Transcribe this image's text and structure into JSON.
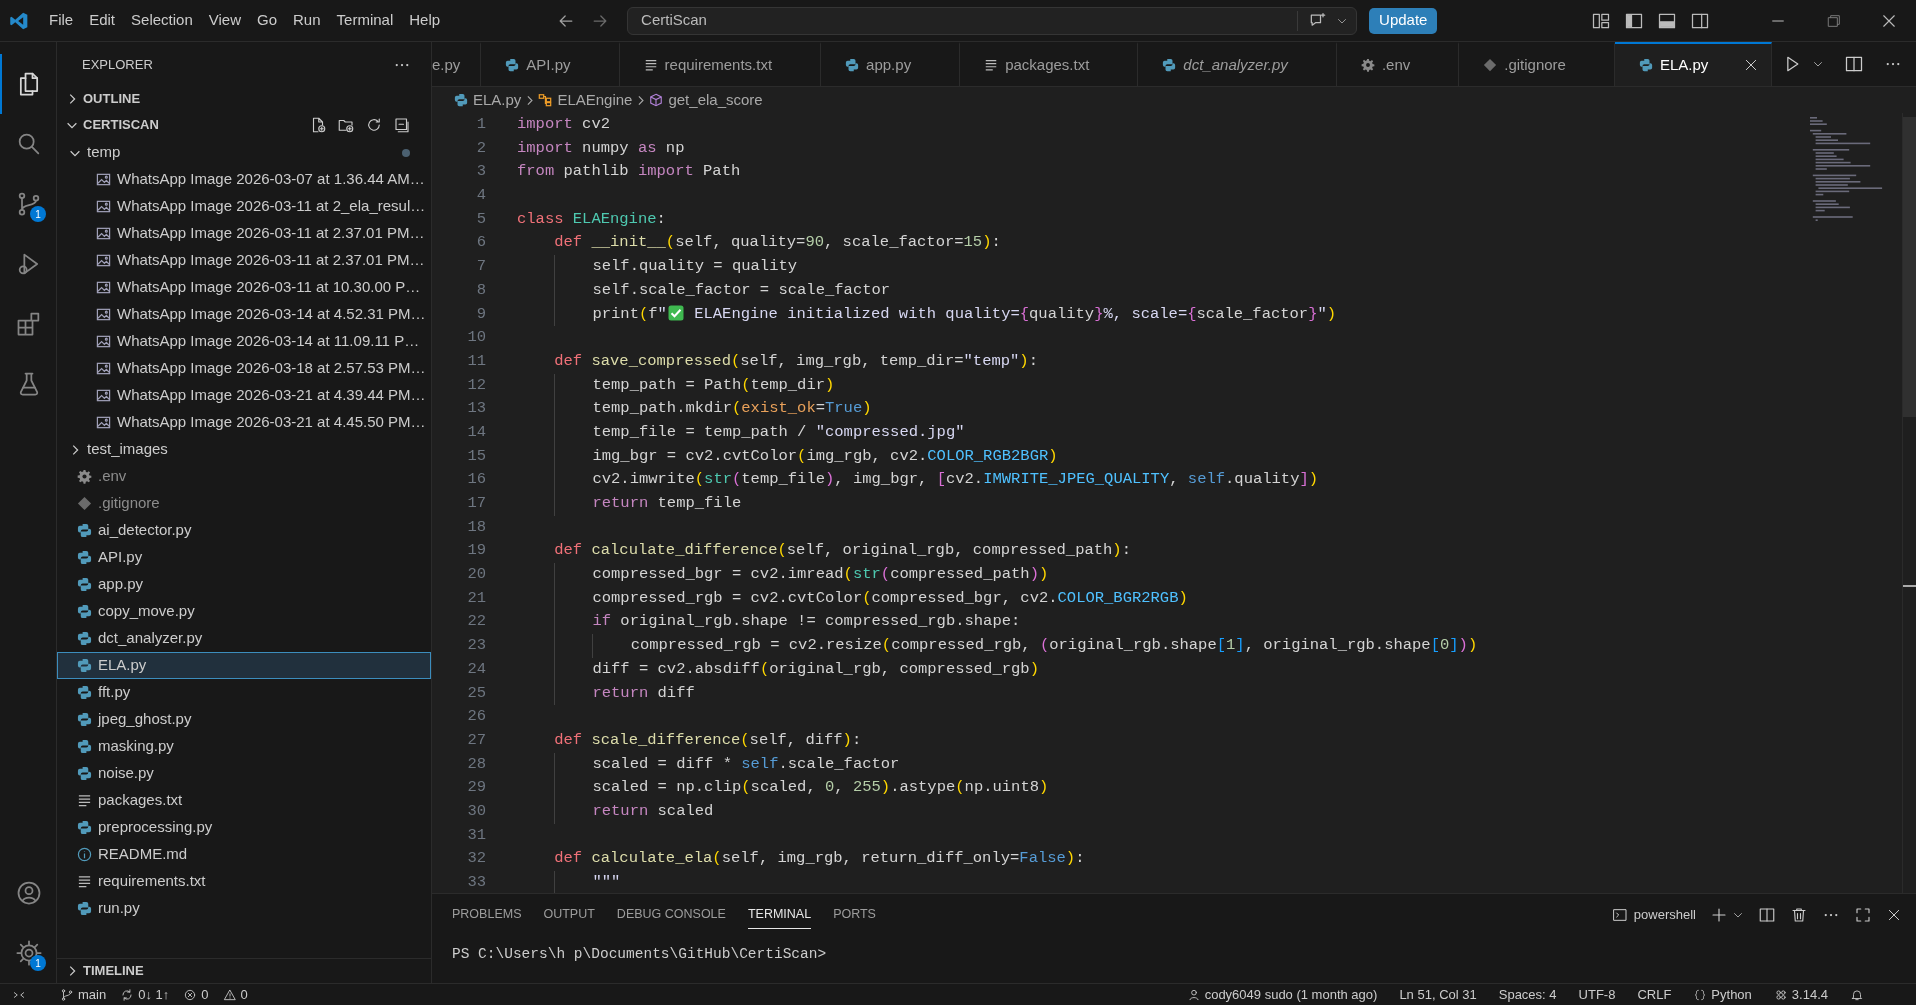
{
  "title_bar": {
    "menu": [
      "File",
      "Edit",
      "Selection",
      "View",
      "Go",
      "Run",
      "Terminal",
      "Help"
    ],
    "search": "CertiScan",
    "update_button": "Update"
  },
  "activity_bar": {
    "items": [
      {
        "selected": true
      },
      {
        "selected": false
      },
      {
        "selected": false,
        "badge": "1"
      },
      {
        "selected": false
      },
      {
        "selected": false
      },
      {
        "selected": false
      }
    ],
    "bottom_items": [
      {
        "selected": false
      },
      {
        "selected": false,
        "badge": "1"
      }
    ]
  },
  "sidebar": {
    "title": "EXPLORER",
    "outline": {
      "label": "OUTLINE",
      "expanded": false
    },
    "project": {
      "label": "CERTISCAN",
      "expanded": true,
      "items": [
        {
          "label": "temp",
          "kind": "folder",
          "expanded": true,
          "modified": true,
          "selected": false,
          "ignored": false,
          "children": [
            {
              "label": "WhatsApp Image 2026-03-07 at 1.36.44 AM…",
              "kind": "image",
              "selected": false,
              "ignored": false
            },
            {
              "label": "WhatsApp Image 2026-03-11 at 2_ela_resul…",
              "kind": "image",
              "selected": false,
              "ignored": false
            },
            {
              "label": "WhatsApp Image 2026-03-11 at 2.37.01 PM…",
              "kind": "image",
              "selected": false,
              "ignored": false
            },
            {
              "label": "WhatsApp Image 2026-03-11 at 2.37.01 PM…",
              "kind": "image",
              "selected": false,
              "ignored": false
            },
            {
              "label": "WhatsApp Image 2026-03-11 at 10.30.00 P…",
              "kind": "image",
              "selected": false,
              "ignored": false
            },
            {
              "label": "WhatsApp Image 2026-03-14 at 4.52.31 PM…",
              "kind": "image",
              "selected": false,
              "ignored": false
            },
            {
              "label": "WhatsApp Image 2026-03-14 at 11.09.11 P…",
              "kind": "image",
              "selected": false,
              "ignored": false
            },
            {
              "label": "WhatsApp Image 2026-03-18 at 2.57.53 PM…",
              "kind": "image",
              "selected": false,
              "ignored": false
            },
            {
              "label": "WhatsApp Image 2026-03-21 at 4.39.44 PM…",
              "kind": "image",
              "selected": false,
              "ignored": false
            },
            {
              "label": "WhatsApp Image 2026-03-21 at 4.45.50 PM…",
              "kind": "image",
              "selected": false,
              "ignored": false
            }
          ]
        },
        {
          "label": "test_images",
          "kind": "folder",
          "expanded": false,
          "modified": false,
          "selected": false,
          "ignored": false
        },
        {
          "label": ".env",
          "kind": "gear",
          "selected": false,
          "ignored": true
        },
        {
          "label": ".gitignore",
          "kind": "git",
          "selected": false,
          "ignored": true
        },
        {
          "label": "ai_detector.py",
          "kind": "python",
          "selected": false,
          "ignored": false
        },
        {
          "label": "API.py",
          "kind": "python",
          "selected": false,
          "ignored": false
        },
        {
          "label": "app.py",
          "kind": "python",
          "selected": false,
          "ignored": false
        },
        {
          "label": "copy_move.py",
          "kind": "python",
          "selected": false,
          "ignored": false
        },
        {
          "label": "dct_analyzer.py",
          "kind": "python",
          "selected": false,
          "ignored": false
        },
        {
          "label": "ELA.py",
          "kind": "python",
          "selected": true,
          "ignored": false
        },
        {
          "label": "fft.py",
          "kind": "python",
          "selected": false,
          "ignored": false
        },
        {
          "label": "jpeg_ghost.py",
          "kind": "python",
          "selected": false,
          "ignored": false
        },
        {
          "label": "masking.py",
          "kind": "python",
          "selected": false,
          "ignored": false
        },
        {
          "label": "noise.py",
          "kind": "python",
          "selected": false,
          "ignored": false
        },
        {
          "label": "packages.txt",
          "kind": "text",
          "selected": false,
          "ignored": false
        },
        {
          "label": "preprocessing.py",
          "kind": "python",
          "selected": false,
          "ignored": false
        },
        {
          "label": "README.md",
          "kind": "info",
          "selected": false,
          "ignored": false
        },
        {
          "label": "requirements.txt",
          "kind": "text",
          "selected": false,
          "ignored": false
        },
        {
          "label": "run.py",
          "kind": "python",
          "selected": false,
          "ignored": false
        }
      ]
    },
    "timeline": {
      "label": "TIMELINE",
      "expanded": false
    }
  },
  "tabs": [
    {
      "label": "e.py",
      "kind": "partial",
      "selected": false,
      "preview": false
    },
    {
      "label": "API.py",
      "kind": "python",
      "selected": false,
      "preview": false
    },
    {
      "label": "requirements.txt",
      "kind": "text",
      "selected": false,
      "preview": false
    },
    {
      "label": "app.py",
      "kind": "python",
      "selected": false,
      "preview": false
    },
    {
      "label": "packages.txt",
      "kind": "text",
      "selected": false,
      "preview": false
    },
    {
      "label": "dct_analyzer.py",
      "kind": "python",
      "selected": false,
      "preview": true
    },
    {
      "label": ".env",
      "kind": "gear",
      "selected": false,
      "preview": false
    },
    {
      "label": ".gitignore",
      "kind": "git",
      "selected": false,
      "preview": false
    },
    {
      "label": "ELA.py",
      "kind": "python",
      "selected": true,
      "preview": false
    }
  ],
  "breadcrumb": [
    {
      "label": "ELA.py",
      "kind": "python"
    },
    {
      "label": "ELAEngine",
      "kind": "class"
    },
    {
      "label": "get_ela_score",
      "kind": "method"
    }
  ],
  "code": {
    "lines": [
      {
        "number": "1",
        "tokens": [
          {
            "kind": "kw",
            "text": "import"
          },
          {
            "kind": "plain",
            "text": " cv2"
          }
        ]
      },
      {
        "number": "2",
        "tokens": [
          {
            "kind": "kw",
            "text": "import"
          },
          {
            "kind": "plain",
            "text": " numpy "
          },
          {
            "kind": "kw",
            "text": "as"
          },
          {
            "kind": "plain",
            "text": " np"
          }
        ]
      },
      {
        "number": "3",
        "tokens": [
          {
            "kind": "kw",
            "text": "from"
          },
          {
            "kind": "plain",
            "text": " pathlib "
          },
          {
            "kind": "kw",
            "text": "import"
          },
          {
            "kind": "plain",
            "text": " Path"
          }
        ]
      },
      {
        "number": "4"
      },
      {
        "number": "5",
        "tokens": [
          {
            "kind": "def",
            "text": "class "
          },
          {
            "kind": "cls",
            "text": "ELAEngine"
          },
          {
            "kind": "plain",
            "text": ":"
          }
        ]
      },
      {
        "number": "6",
        "tokens": [
          {
            "kind": "def",
            "text": "    def "
          },
          {
            "kind": "fn",
            "text": "__init__"
          },
          {
            "kind": "b1",
            "text": "("
          },
          {
            "kind": "plain",
            "text": "self, quality="
          },
          {
            "kind": "num",
            "text": "90"
          },
          {
            "kind": "plain",
            "text": ", scale_factor="
          },
          {
            "kind": "num",
            "text": "15"
          },
          {
            "kind": "b1",
            "text": ")"
          },
          {
            "kind": "plain",
            "text": ":"
          }
        ]
      },
      {
        "number": "7",
        "tokens": [
          {
            "kind": "plain",
            "text": "        self.quality = quality"
          }
        ]
      },
      {
        "number": "8",
        "tokens": [
          {
            "kind": "plain",
            "text": "        self.scale_factor = scale_factor"
          }
        ]
      },
      {
        "number": "9",
        "tokens": [
          {
            "kind": "plain",
            "text": "        print"
          },
          {
            "kind": "b1",
            "text": "("
          },
          {
            "kind": "plain",
            "text": "f"
          },
          {
            "kind": "str",
            "text": "\""
          },
          {
            "kind": "check"
          },
          {
            "kind": "str",
            "text": " ELAEngine initialized with quality="
          },
          {
            "kind": "b2",
            "text": "{"
          },
          {
            "kind": "plain",
            "text": "quality"
          },
          {
            "kind": "b2",
            "text": "}"
          },
          {
            "kind": "str",
            "text": "%, scale="
          },
          {
            "kind": "b2",
            "text": "{"
          },
          {
            "kind": "plain",
            "text": "scale_factor"
          },
          {
            "kind": "b2",
            "text": "}"
          },
          {
            "kind": "str",
            "text": "\""
          },
          {
            "kind": "b1",
            "text": ")"
          }
        ]
      },
      {
        "number": "10"
      },
      {
        "number": "11",
        "tokens": [
          {
            "kind": "def",
            "text": "    def "
          },
          {
            "kind": "fn",
            "text": "save_compressed"
          },
          {
            "kind": "b1",
            "text": "("
          },
          {
            "kind": "plain",
            "text": "self, img_rgb, temp_dir="
          },
          {
            "kind": "str",
            "text": "\"temp\""
          },
          {
            "kind": "b1",
            "text": ")"
          },
          {
            "kind": "plain",
            "text": ":"
          }
        ]
      },
      {
        "number": "12",
        "tokens": [
          {
            "kind": "plain",
            "text": "        temp_path = Path"
          },
          {
            "kind": "b1",
            "text": "("
          },
          {
            "kind": "plain",
            "text": "temp_dir"
          },
          {
            "kind": "b1",
            "text": ")"
          }
        ]
      },
      {
        "number": "13",
        "tokens": [
          {
            "kind": "plain",
            "text": "        temp_path.mkdir"
          },
          {
            "kind": "b1",
            "text": "("
          },
          {
            "kind": "param",
            "text": "exist_ok"
          },
          {
            "kind": "plain",
            "text": "="
          },
          {
            "kind": "bool",
            "text": "True"
          },
          {
            "kind": "b1",
            "text": ")"
          }
        ]
      },
      {
        "number": "14",
        "tokens": [
          {
            "kind": "plain",
            "text": "        temp_file = temp_path / "
          },
          {
            "kind": "str",
            "text": "\"compressed.jpg\""
          }
        ]
      },
      {
        "number": "15",
        "tokens": [
          {
            "kind": "plain",
            "text": "        img_bgr = cv2.cvtColor"
          },
          {
            "kind": "b1",
            "text": "("
          },
          {
            "kind": "plain",
            "text": "img_rgb, cv2."
          },
          {
            "kind": "const",
            "text": "COLOR_RGB2BGR"
          },
          {
            "kind": "b1",
            "text": ")"
          }
        ]
      },
      {
        "number": "16",
        "tokens": [
          {
            "kind": "plain",
            "text": "        cv2.imwrite"
          },
          {
            "kind": "b1",
            "text": "("
          },
          {
            "kind": "builtin",
            "text": "str"
          },
          {
            "kind": "b2",
            "text": "("
          },
          {
            "kind": "plain",
            "text": "temp_file"
          },
          {
            "kind": "b2",
            "text": ")"
          },
          {
            "kind": "plain",
            "text": ", img_bgr, "
          },
          {
            "kind": "b2",
            "text": "["
          },
          {
            "kind": "plain",
            "text": "cv2."
          },
          {
            "kind": "const",
            "text": "IMWRITE_JPEG_QUALITY"
          },
          {
            "kind": "plain",
            "text": ", "
          },
          {
            "kind": "self",
            "text": "self"
          },
          {
            "kind": "plain",
            "text": ".quality"
          },
          {
            "kind": "b2",
            "text": "]"
          },
          {
            "kind": "b1",
            "text": ")"
          }
        ]
      },
      {
        "number": "17",
        "tokens": [
          {
            "kind": "kw",
            "text": "        return"
          },
          {
            "kind": "plain",
            "text": " temp_file"
          }
        ]
      },
      {
        "number": "18"
      },
      {
        "number": "19",
        "tokens": [
          {
            "kind": "def",
            "text": "    def "
          },
          {
            "kind": "fn",
            "text": "calculate_difference"
          },
          {
            "kind": "b1",
            "text": "("
          },
          {
            "kind": "plain",
            "text": "self, original_rgb, compressed_path"
          },
          {
            "kind": "b1",
            "text": ")"
          },
          {
            "kind": "plain",
            "text": ":"
          }
        ]
      },
      {
        "number": "20",
        "tokens": [
          {
            "kind": "plain",
            "text": "        compressed_bgr = cv2.imread"
          },
          {
            "kind": "b1",
            "text": "("
          },
          {
            "kind": "builtin",
            "text": "str"
          },
          {
            "kind": "b2",
            "text": "("
          },
          {
            "kind": "plain",
            "text": "compressed_path"
          },
          {
            "kind": "b2",
            "text": ")"
          },
          {
            "kind": "b1",
            "text": ")"
          }
        ]
      },
      {
        "number": "21",
        "tokens": [
          {
            "kind": "plain",
            "text": "        compressed_rgb = cv2.cvtColor"
          },
          {
            "kind": "b1",
            "text": "("
          },
          {
            "kind": "plain",
            "text": "compressed_bgr, cv2."
          },
          {
            "kind": "const",
            "text": "COLOR_BGR2RGB"
          },
          {
            "kind": "b1",
            "text": ")"
          }
        ]
      },
      {
        "number": "22",
        "tokens": [
          {
            "kind": "kw",
            "text": "        if"
          },
          {
            "kind": "plain",
            "text": " original_rgb.shape != compressed_rgb.shape:"
          }
        ]
      },
      {
        "number": "23",
        "tokens": [
          {
            "kind": "plain",
            "text": "            compressed_rgb = cv2.resize"
          },
          {
            "kind": "b1",
            "text": "("
          },
          {
            "kind": "plain",
            "text": "compressed_rgb, "
          },
          {
            "kind": "b2",
            "text": "("
          },
          {
            "kind": "plain",
            "text": "original_rgb.shape"
          },
          {
            "kind": "b3",
            "text": "["
          },
          {
            "kind": "num",
            "text": "1"
          },
          {
            "kind": "b3",
            "text": "]"
          },
          {
            "kind": "plain",
            "text": ", original_rgb.shape"
          },
          {
            "kind": "b3",
            "text": "["
          },
          {
            "kind": "num",
            "text": "0"
          },
          {
            "kind": "b3",
            "text": "]"
          },
          {
            "kind": "b2",
            "text": ")"
          },
          {
            "kind": "b1",
            "text": ")"
          }
        ]
      },
      {
        "number": "24",
        "tokens": [
          {
            "kind": "plain",
            "text": "        diff = cv2.absdiff"
          },
          {
            "kind": "b1",
            "text": "("
          },
          {
            "kind": "plain",
            "text": "original_rgb, compressed_rgb"
          },
          {
            "kind": "b1",
            "text": ")"
          }
        ]
      },
      {
        "number": "25",
        "tokens": [
          {
            "kind": "kw",
            "text": "        return"
          },
          {
            "kind": "plain",
            "text": " diff"
          }
        ]
      },
      {
        "number": "26"
      },
      {
        "number": "27",
        "tokens": [
          {
            "kind": "def",
            "text": "    def "
          },
          {
            "kind": "fn",
            "text": "scale_difference"
          },
          {
            "kind": "b1",
            "text": "("
          },
          {
            "kind": "plain",
            "text": "self, diff"
          },
          {
            "kind": "b1",
            "text": ")"
          },
          {
            "kind": "plain",
            "text": ":"
          }
        ]
      },
      {
        "number": "28",
        "tokens": [
          {
            "kind": "plain",
            "text": "        scaled = diff * "
          },
          {
            "kind": "self",
            "text": "self"
          },
          {
            "kind": "plain",
            "text": ".scale_factor"
          }
        ]
      },
      {
        "number": "29",
        "tokens": [
          {
            "kind": "plain",
            "text": "        scaled = np.clip"
          },
          {
            "kind": "b1",
            "text": "("
          },
          {
            "kind": "plain",
            "text": "scaled, "
          },
          {
            "kind": "num",
            "text": "0"
          },
          {
            "kind": "plain",
            "text": ", "
          },
          {
            "kind": "num",
            "text": "255"
          },
          {
            "kind": "b1",
            "text": ")"
          },
          {
            "kind": "plain",
            "text": ".astype"
          },
          {
            "kind": "b1",
            "text": "("
          },
          {
            "kind": "plain",
            "text": "np.uint8"
          },
          {
            "kind": "b1",
            "text": ")"
          }
        ]
      },
      {
        "number": "30",
        "tokens": [
          {
            "kind": "kw",
            "text": "        return"
          },
          {
            "kind": "plain",
            "text": " scaled"
          }
        ]
      },
      {
        "number": "31"
      },
      {
        "number": "32",
        "tokens": [
          {
            "kind": "def",
            "text": "    def "
          },
          {
            "kind": "fn",
            "text": "calculate_ela"
          },
          {
            "kind": "b1",
            "text": "("
          },
          {
            "kind": "plain",
            "text": "self, img_rgb, return_diff_only="
          },
          {
            "kind": "bool",
            "text": "False"
          },
          {
            "kind": "b1",
            "text": ")"
          },
          {
            "kind": "plain",
            "text": ":"
          }
        ]
      },
      {
        "number": "33",
        "tokens": [
          {
            "kind": "str",
            "text": "        \"\"\""
          }
        ]
      }
    ]
  },
  "panel": {
    "tabs": [
      {
        "label": "PROBLEMS",
        "selected": false
      },
      {
        "label": "OUTPUT",
        "selected": false
      },
      {
        "label": "DEBUG CONSOLE",
        "selected": false
      },
      {
        "label": "TERMINAL",
        "selected": true
      },
      {
        "label": "PORTS",
        "selected": false
      }
    ],
    "shell": "powershell",
    "terminal_lines": [
      "PS C:\\Users\\h p\\Documents\\GitHub\\CertiScan>"
    ]
  },
  "status_bar": {
    "left": [
      {
        "kind": "branch",
        "text": "main"
      },
      {
        "kind": "sync",
        "text": "0↓ 1↑"
      },
      {
        "kind": "error",
        "text": "0"
      },
      {
        "kind": "warning",
        "text": "0"
      }
    ],
    "right": [
      {
        "kind": "person",
        "text": "cody6049 sudo (1 month ago)"
      },
      {
        "kind": "plain",
        "text": "Ln 51, Col 31"
      },
      {
        "kind": "plain",
        "text": "Spaces: 4"
      },
      {
        "kind": "plain",
        "text": "UTF-8"
      },
      {
        "kind": "plain",
        "text": "CRLF"
      },
      {
        "kind": "braces",
        "text": "Python"
      },
      {
        "kind": "env",
        "text": "3.14.4"
      }
    ]
  }
}
